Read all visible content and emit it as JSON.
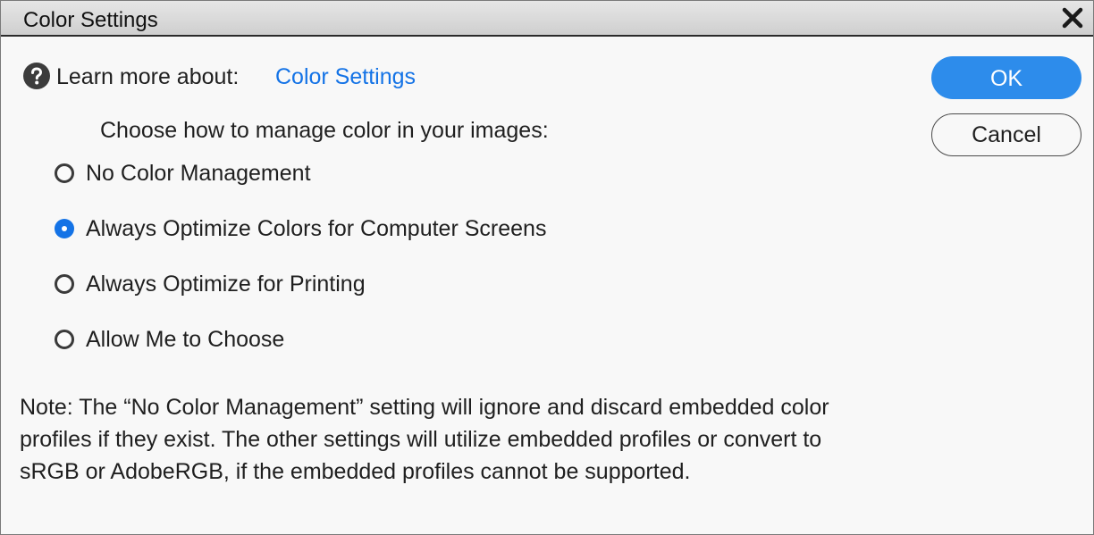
{
  "window": {
    "title": "Color Settings",
    "close_icon": "close-x-icon"
  },
  "help": {
    "icon": "question-circle-icon",
    "label": "Learn more about:",
    "link_text": "Color Settings",
    "link_color": "#1473e6"
  },
  "prompt": "Choose how to manage color in your images:",
  "options": [
    {
      "label": "No Color Management",
      "selected": false
    },
    {
      "label": "Always Optimize Colors for Computer Screens",
      "selected": true
    },
    {
      "label": "Always Optimize for Printing",
      "selected": false
    },
    {
      "label": "Allow Me to Choose",
      "selected": false
    }
  ],
  "note": "Note: The “No Color Management” setting will ignore and discard embedded color profiles if they exist. The other settings will utilize embedded profiles or convert to sRGB or AdobeRGB, if the embedded profiles cannot be supported.",
  "buttons": {
    "ok_label": "OK",
    "cancel_label": "Cancel",
    "ok_color": "#2d8ceb"
  }
}
